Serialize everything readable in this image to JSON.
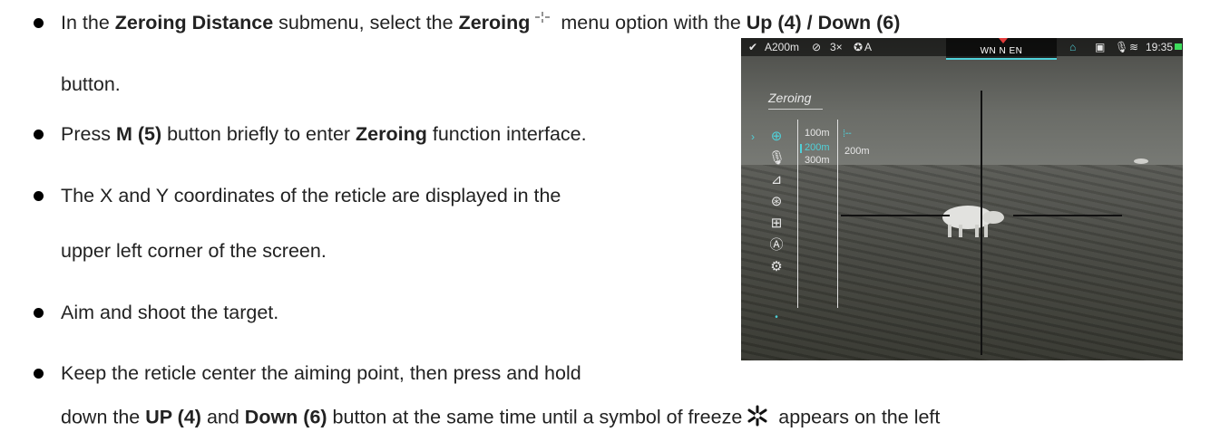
{
  "instructions": {
    "line1": {
      "t1": "In the ",
      "b1": "Zeroing Distance",
      "t2": " submenu, select the ",
      "b2": "Zeroing",
      "t3": " menu option with the ",
      "b3": "Up (4) / Down (6)"
    },
    "line1b": "button.",
    "line2": {
      "t1": "Press ",
      "b1": "M (5)",
      "t2": " button briefly to enter ",
      "b2": "Zeroing",
      "t3": " function interface."
    },
    "line3": "The X and Y coordinates of the reticle are displayed in the",
    "line3b": "upper left corner of the screen.",
    "line4": "Aim and shoot the target.",
    "line5": "Keep the reticle center the aiming point, then press and hold",
    "line6": {
      "t1": "down the ",
      "b1": "UP (4)",
      "t2": " and ",
      "b2": "Down (6)",
      "t3": " button at the same time until a symbol of freeze",
      "t4": " appears on the left"
    }
  },
  "device": {
    "status": {
      "distance": "A200m",
      "zoom": "3×",
      "mode": "A",
      "compass": "WN  N  EN",
      "time": "19:35"
    },
    "menu_title": "Zeroing",
    "distances": [
      "100m",
      "200m",
      "300m"
    ],
    "selected_distance": "200m"
  },
  "colors": {
    "accent": "#4fd1d9",
    "north_marker": "#e23b3b"
  }
}
